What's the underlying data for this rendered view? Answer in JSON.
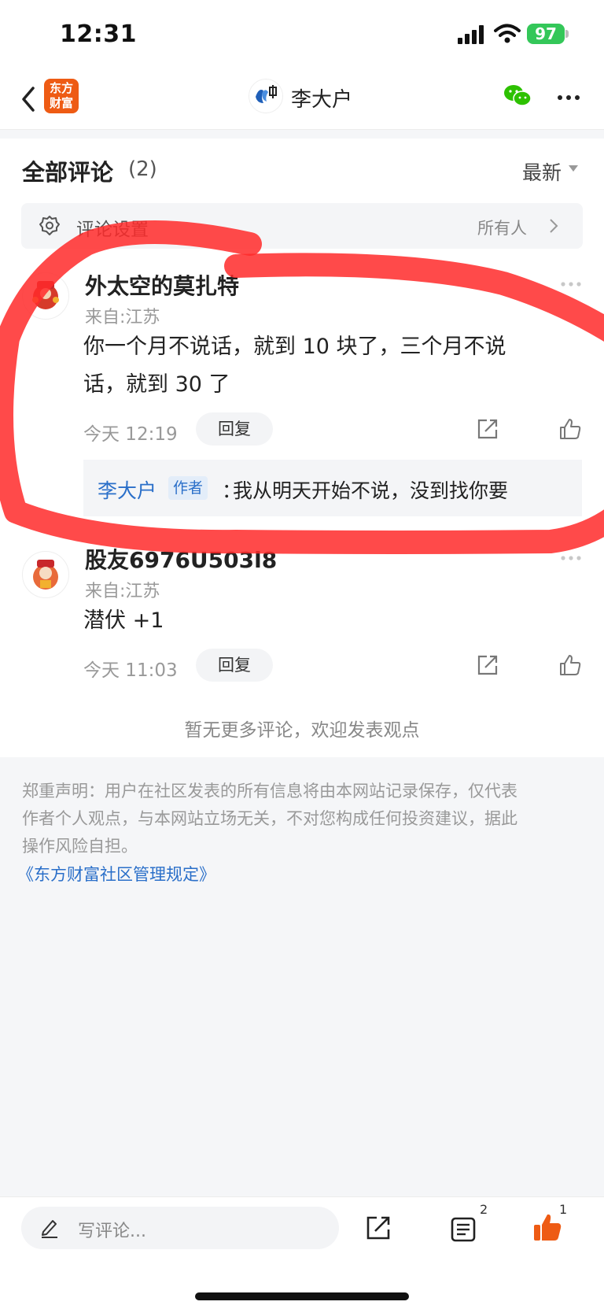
{
  "status_bar": {
    "time": "12:31",
    "battery": "97"
  },
  "nav": {
    "app_logo_text_line1": "东方",
    "app_logo_text_line2": "财富",
    "title": "李大户",
    "icons": [
      "back-chevron-icon",
      "wechat-icon",
      "more-dots-icon"
    ]
  },
  "comments_header": {
    "title": "全部评论",
    "count": "(2)",
    "sort_label": "最新"
  },
  "settings": {
    "label": "评论设置",
    "value": "所有人"
  },
  "comments": [
    {
      "author": "外太空的莫扎特",
      "location": "来自:江苏",
      "text": "你一个月不说话，就到 10 块了，三个月不说话，就到 30 了",
      "text_line1": "你一个月不说话，就到 10 块了，三个月不说",
      "text_line2": "话，就到 30 了",
      "time": "今天 12:19",
      "reply_label": "回复",
      "sub_reply": {
        "author": "李大户",
        "badge": "作者",
        "colon": "：",
        "text": "我从明天开始不说，没到找你要"
      }
    },
    {
      "author": "股友6976U503l8",
      "location": "来自:江苏",
      "text": "潜伏 +1",
      "time": "今天 11:03",
      "reply_label": "回复"
    }
  ],
  "no_more_text": "暂无更多评论，欢迎发表观点",
  "disclaimer": {
    "line1": "郑重声明：用户在社区发表的所有信息将由本网站记录保存，仅代表",
    "line2": "作者个人观点，与本网站立场无关，不对您构成任何投资建议，据此",
    "line3": "操作风险自担。",
    "link": "《东方财富社区管理规定》"
  },
  "bottom_bar": {
    "write_placeholder": "写评论...",
    "comments_count": "2",
    "likes_count": "1"
  },
  "colors": {
    "accent_orange": "#ee5b14",
    "link_blue": "#2a6fc9",
    "annotation_red": "#ff2a2a"
  }
}
